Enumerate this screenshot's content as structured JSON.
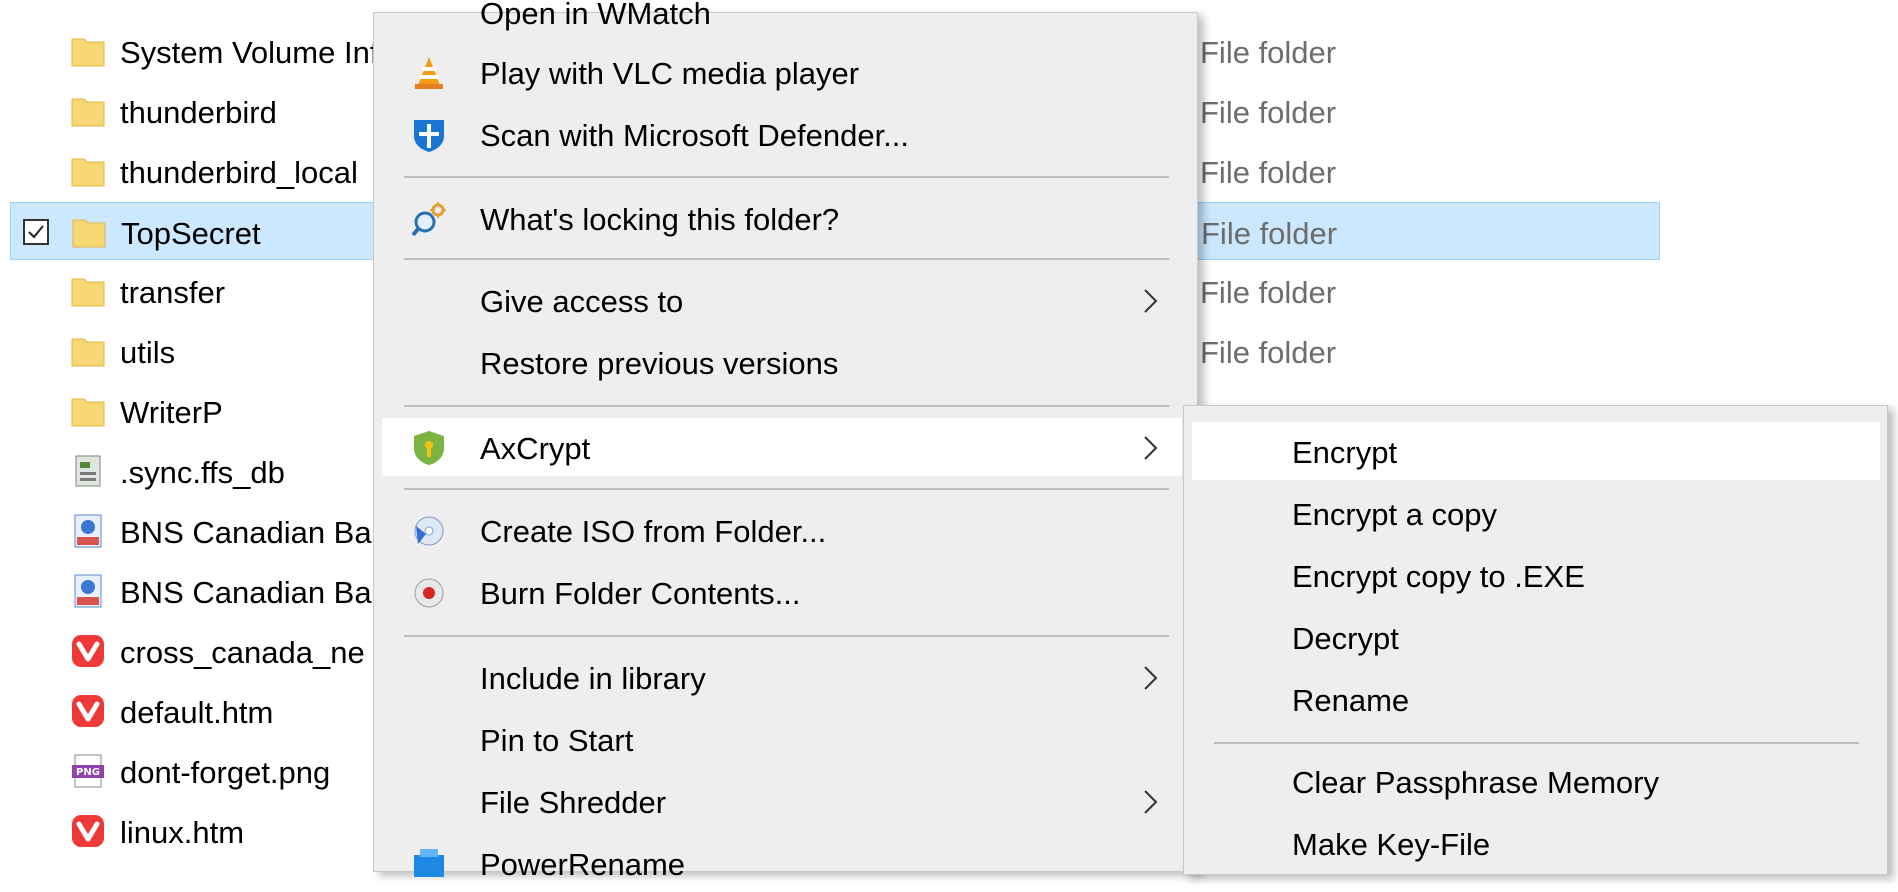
{
  "files": [
    {
      "name": "System Volume Information",
      "type": "File folder",
      "icon": "folder-icon",
      "selected": false
    },
    {
      "name": "thunderbird",
      "type": "File folder",
      "icon": "folder-icon",
      "selected": false
    },
    {
      "name": "thunderbird_local",
      "type": "File folder",
      "icon": "folder-icon",
      "selected": false
    },
    {
      "name": "TopSecret",
      "type": "File folder",
      "icon": "folder-icon",
      "selected": true
    },
    {
      "name": "transfer",
      "type": "File folder",
      "icon": "folder-icon",
      "selected": false
    },
    {
      "name": "utils",
      "type": "File folder",
      "icon": "folder-icon",
      "selected": false
    },
    {
      "name": "WriterP",
      "type": "File folder",
      "icon": "folder-icon",
      "selected": false
    },
    {
      "name": ".sync.ffs_db",
      "type": "",
      "icon": "database-file-icon",
      "selected": false
    },
    {
      "name": "BNS Canadian Ba",
      "type": "",
      "icon": "pdf-file-icon",
      "selected": false
    },
    {
      "name": "BNS Canadian Ba",
      "type": "",
      "icon": "pdf-file-icon",
      "selected": false
    },
    {
      "name": "cross_canada_ne",
      "type": "",
      "icon": "vivaldi-html-icon",
      "selected": false
    },
    {
      "name": "default.htm",
      "type": "",
      "icon": "vivaldi-html-icon",
      "selected": false
    },
    {
      "name": "dont-forget.png",
      "type": "",
      "icon": "png-file-icon",
      "selected": false
    },
    {
      "name": "linux.htm",
      "type": "",
      "icon": "vivaldi-html-icon",
      "selected": false
    }
  ],
  "context_menu": {
    "items": [
      {
        "label": "Open in WMatch",
        "icon": "",
        "submenu": false
      },
      {
        "label": "Play with VLC media player",
        "icon": "vlc-icon",
        "submenu": false
      },
      {
        "label": "Scan with Microsoft Defender...",
        "icon": "defender-shield-icon",
        "submenu": false
      },
      {
        "label": "What's locking this folder?",
        "icon": "lock-search-icon",
        "submenu": false
      },
      {
        "label": "Give access to",
        "icon": "",
        "submenu": true
      },
      {
        "label": "Restore previous versions",
        "icon": "",
        "submenu": false
      },
      {
        "label": "AxCrypt",
        "icon": "axcrypt-icon",
        "submenu": true,
        "hovered": true
      },
      {
        "label": "Create ISO from Folder...",
        "icon": "iso-icon",
        "submenu": false
      },
      {
        "label": "Burn Folder Contents...",
        "icon": "burn-disc-icon",
        "submenu": false
      },
      {
        "label": "Include in library",
        "icon": "",
        "submenu": true
      },
      {
        "label": "Pin to Start",
        "icon": "",
        "submenu": false
      },
      {
        "label": "File Shredder",
        "icon": "",
        "submenu": true
      },
      {
        "label": "PowerRename",
        "icon": "powerrename-icon",
        "submenu": false
      }
    ]
  },
  "axcrypt_submenu": {
    "items": [
      {
        "label": "Encrypt",
        "hovered": true
      },
      {
        "label": "Encrypt a copy"
      },
      {
        "label": "Encrypt copy to .EXE"
      },
      {
        "label": "Decrypt"
      },
      {
        "label": "Rename"
      },
      {
        "label": "Clear Passphrase Memory"
      },
      {
        "label": "Make Key-File"
      }
    ]
  },
  "colors": {
    "selection_bg": "#cce8ff",
    "menu_bg": "#eeeeee",
    "hover_bg": "#ffffff",
    "folder_yellow": "#f8d775",
    "vivaldi_red": "#ef3939"
  }
}
